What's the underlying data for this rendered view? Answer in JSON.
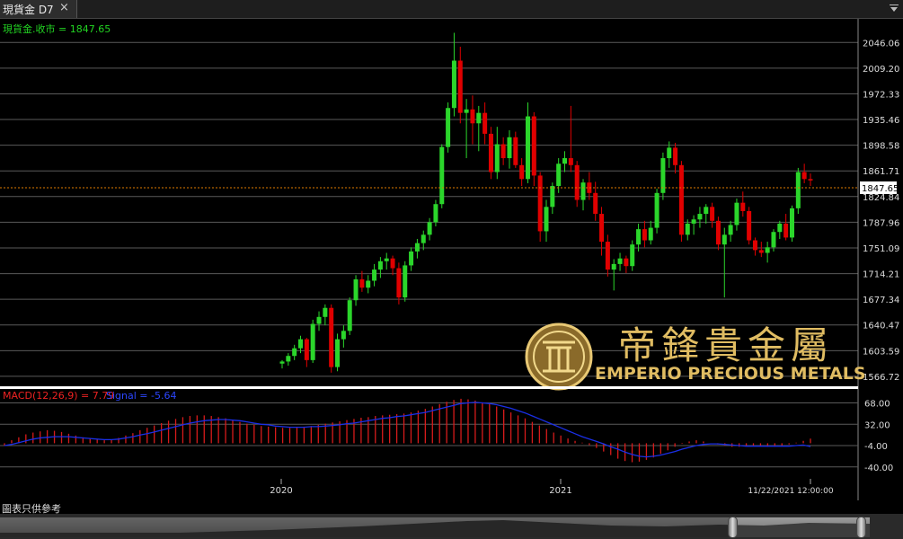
{
  "tab": {
    "title": "現貨金 D7",
    "close": "×"
  },
  "price_panel": {
    "label": "現貨金.收市 = 1847.65",
    "last_price_tag": "1847.65"
  },
  "macd_panel": {
    "label_macd": "MACD(12,26,9) = 7.79",
    "label_signal": "Signal = -5.64"
  },
  "footer": {
    "note": "圖表只供參考"
  },
  "watermark": {
    "chinese": "帝鋒貴金屬",
    "english": "EMPERIO PRECIOUS METALS"
  },
  "colors": {
    "up": "#2bd62b",
    "down": "#e00000",
    "signal": "#1a2fe6",
    "macd_bar": "#d71b1b",
    "grid": "#5a5a5a",
    "price_line": "#e07b00",
    "label_green": "#22d322",
    "gold": "#d9b25a"
  },
  "chart_data": [
    {
      "type": "candlestick",
      "title": "現貨金 D7",
      "series": [
        {
          "name": "現貨金.收市",
          "last_value": 1847.65
        }
      ],
      "y_ticks": [
        "2046.06",
        "2009.20",
        "1972.33",
        "1935.46",
        "1898.58",
        "1861.71",
        "1824.84",
        "1787.96",
        "1751.09",
        "1714.21",
        "1677.34",
        "1640.47",
        "1603.59",
        "1566.72"
      ],
      "ylim": [
        1555,
        2080
      ],
      "x_ticks": [
        "2020",
        "2021",
        "11/22/2021 12:00:00"
      ],
      "candles": [
        [
          1585,
          1590,
          1578,
          1588
        ],
        [
          1588,
          1600,
          1582,
          1596
        ],
        [
          1596,
          1612,
          1590,
          1607
        ],
        [
          1607,
          1625,
          1600,
          1620
        ],
        [
          1620,
          1622,
          1580,
          1590
        ],
        [
          1590,
          1648,
          1586,
          1642
        ],
        [
          1642,
          1660,
          1632,
          1652
        ],
        [
          1652,
          1670,
          1640,
          1665
        ],
        [
          1665,
          1670,
          1572,
          1580
        ],
        [
          1580,
          1628,
          1574,
          1620
        ],
        [
          1620,
          1640,
          1608,
          1632
        ],
        [
          1632,
          1680,
          1626,
          1676
        ],
        [
          1676,
          1712,
          1668,
          1706
        ],
        [
          1706,
          1718,
          1688,
          1694
        ],
        [
          1694,
          1712,
          1686,
          1704
        ],
        [
          1704,
          1728,
          1696,
          1720
        ],
        [
          1720,
          1738,
          1708,
          1732
        ],
        [
          1732,
          1744,
          1720,
          1736
        ],
        [
          1736,
          1740,
          1712,
          1722
        ],
        [
          1722,
          1730,
          1670,
          1680
        ],
        [
          1680,
          1732,
          1674,
          1726
        ],
        [
          1726,
          1752,
          1718,
          1746
        ],
        [
          1746,
          1764,
          1736,
          1758
        ],
        [
          1758,
          1776,
          1748,
          1770
        ],
        [
          1770,
          1794,
          1762,
          1788
        ],
        [
          1788,
          1820,
          1782,
          1814
        ],
        [
          1814,
          1900,
          1808,
          1896
        ],
        [
          1896,
          1960,
          1888,
          1952
        ],
        [
          1952,
          2060,
          1940,
          2020
        ],
        [
          2020,
          2040,
          1930,
          1945
        ],
        [
          1945,
          1965,
          1880,
          1950
        ],
        [
          1950,
          1970,
          1900,
          1930
        ],
        [
          1930,
          1955,
          1890,
          1945
        ],
        [
          1945,
          1960,
          1900,
          1915
        ],
        [
          1915,
          1925,
          1850,
          1860
        ],
        [
          1860,
          1925,
          1850,
          1900
        ],
        [
          1900,
          1910,
          1870,
          1880
        ],
        [
          1880,
          1920,
          1865,
          1910
        ],
        [
          1910,
          1918,
          1866,
          1870
        ],
        [
          1870,
          1880,
          1840,
          1850
        ],
        [
          1850,
          1960,
          1844,
          1940
        ],
        [
          1940,
          1946,
          1840,
          1855
        ],
        [
          1855,
          1860,
          1760,
          1775
        ],
        [
          1775,
          1820,
          1760,
          1810
        ],
        [
          1810,
          1845,
          1800,
          1840
        ],
        [
          1840,
          1880,
          1830,
          1872
        ],
        [
          1872,
          1890,
          1860,
          1880
        ],
        [
          1880,
          1955,
          1860,
          1870
        ],
        [
          1870,
          1876,
          1810,
          1820
        ],
        [
          1820,
          1850,
          1805,
          1845
        ],
        [
          1845,
          1860,
          1820,
          1830
        ],
        [
          1830,
          1846,
          1790,
          1800
        ],
        [
          1800,
          1810,
          1740,
          1760
        ],
        [
          1760,
          1770,
          1710,
          1720
        ],
        [
          1720,
          1735,
          1690,
          1728
        ],
        [
          1728,
          1744,
          1718,
          1736
        ],
        [
          1736,
          1740,
          1715,
          1725
        ],
        [
          1725,
          1762,
          1718,
          1756
        ],
        [
          1756,
          1786,
          1746,
          1778
        ],
        [
          1778,
          1790,
          1752,
          1762
        ],
        [
          1762,
          1790,
          1756,
          1780
        ],
        [
          1780,
          1836,
          1772,
          1830
        ],
        [
          1830,
          1888,
          1820,
          1880
        ],
        [
          1880,
          1904,
          1866,
          1895
        ],
        [
          1895,
          1902,
          1858,
          1870
        ],
        [
          1870,
          1876,
          1760,
          1770
        ],
        [
          1770,
          1792,
          1762,
          1786
        ],
        [
          1786,
          1798,
          1770,
          1792
        ],
        [
          1792,
          1810,
          1780,
          1800
        ],
        [
          1800,
          1814,
          1786,
          1810
        ],
        [
          1810,
          1816,
          1780,
          1790
        ],
        [
          1790,
          1796,
          1748,
          1756
        ],
        [
          1756,
          1780,
          1680,
          1770
        ],
        [
          1770,
          1790,
          1760,
          1784
        ],
        [
          1784,
          1822,
          1776,
          1816
        ],
        [
          1816,
          1832,
          1796,
          1804
        ],
        [
          1804,
          1810,
          1756,
          1762
        ],
        [
          1762,
          1766,
          1740,
          1748
        ],
        [
          1748,
          1760,
          1738,
          1744
        ],
        [
          1744,
          1760,
          1730,
          1752
        ],
        [
          1752,
          1778,
          1746,
          1774
        ],
        [
          1774,
          1790,
          1764,
          1786
        ],
        [
          1786,
          1800,
          1762,
          1766
        ],
        [
          1766,
          1812,
          1760,
          1808
        ],
        [
          1808,
          1866,
          1800,
          1860
        ],
        [
          1860,
          1872,
          1844,
          1850
        ],
        [
          1850,
          1858,
          1840,
          1848
        ]
      ]
    },
    {
      "type": "macd",
      "series": [
        {
          "name": "MACD(12,26,9)",
          "last_value": 7.79
        },
        {
          "name": "Signal",
          "last_value": -5.64
        }
      ],
      "y_ticks": [
        "68.00",
        "32.00",
        "-4.00",
        "-40.00"
      ],
      "ylim": [
        -60,
        90
      ],
      "macd_values": [
        -4,
        5,
        10,
        15,
        18,
        20,
        22,
        21,
        19,
        16,
        13,
        10,
        8,
        6,
        5,
        6,
        9,
        13,
        17,
        22,
        26,
        30,
        34,
        38,
        41,
        44,
        46,
        47,
        47,
        46,
        44,
        42,
        39,
        36,
        33,
        31,
        29,
        28,
        27,
        26,
        26,
        27,
        28,
        29,
        31,
        33,
        35,
        37,
        39,
        41,
        43,
        44,
        46,
        47,
        48,
        49,
        50,
        52,
        55,
        58,
        62,
        66,
        70,
        73,
        75,
        74,
        72,
        69,
        66,
        62,
        57,
        52,
        47,
        42,
        36,
        30,
        24,
        18,
        13,
        8,
        4,
        1,
        -3,
        -8,
        -14,
        -20,
        -26,
        -30,
        -32,
        -31,
        -28,
        -24,
        -18,
        -12,
        -6,
        -1,
        3,
        5,
        3,
        0,
        -2,
        -4,
        -6,
        -6,
        -5,
        -4,
        -5,
        -6,
        -6,
        -4,
        -2,
        1,
        4,
        7.79
      ],
      "signal_values": [
        -4,
        -2,
        1,
        4,
        7,
        9,
        10,
        11,
        11,
        11,
        10,
        9,
        8,
        7,
        6,
        6,
        7,
        9,
        11,
        14,
        16,
        19,
        22,
        25,
        28,
        31,
        34,
        36,
        38,
        39,
        40,
        40,
        39,
        38,
        36,
        34,
        32,
        31,
        29,
        28,
        27,
        27,
        27,
        28,
        28,
        29,
        30,
        31,
        33,
        34,
        36,
        38,
        40,
        42,
        43,
        45,
        46,
        48,
        50,
        52,
        55,
        58,
        61,
        64,
        67,
        68,
        69,
        68,
        67,
        65,
        62,
        59,
        55,
        51,
        46,
        41,
        36,
        31,
        26,
        21,
        16,
        11,
        7,
        3,
        -1,
        -6,
        -10,
        -15,
        -19,
        -22,
        -23,
        -22,
        -20,
        -17,
        -14,
        -10,
        -7,
        -4,
        -2,
        -1,
        -1,
        -2,
        -3,
        -4,
        -5,
        -5,
        -5,
        -5,
        -5,
        -5,
        -5,
        -4,
        -3,
        -5.64
      ]
    }
  ]
}
